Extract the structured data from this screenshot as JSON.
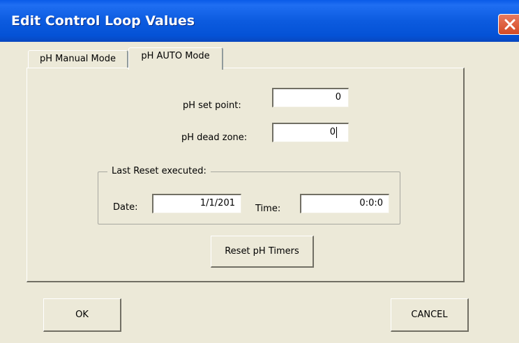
{
  "window": {
    "title": "Edit Control Loop Values",
    "close_icon": "close-icon",
    "titlebar_color": "#0A5BE8"
  },
  "tabs": [
    {
      "label": "pH Manual Mode",
      "selected": false
    },
    {
      "label": "pH AUTO Mode",
      "selected": true
    }
  ],
  "fields": {
    "set_point": {
      "label": "pH set point:",
      "value": "0"
    },
    "dead_zone": {
      "label": "pH dead zone:",
      "value": "0"
    }
  },
  "last_reset": {
    "title": "Last Reset executed:",
    "date_label": "Date:",
    "date_value": "1/1/201",
    "time_label": "Time:",
    "time_value": "0:0:0"
  },
  "buttons": {
    "reset": "Reset pH Timers",
    "ok": "OK",
    "cancel": "CANCEL"
  }
}
